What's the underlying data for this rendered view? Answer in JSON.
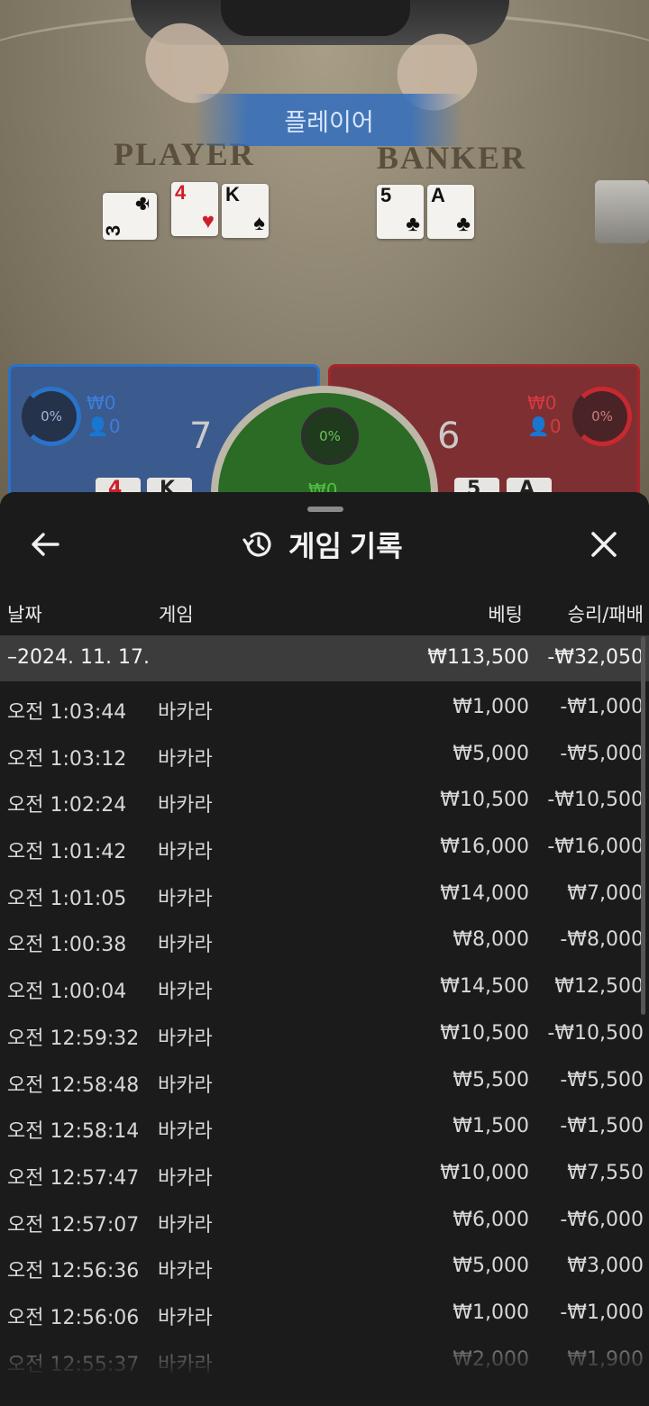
{
  "game": {
    "result_banner": "플레이어",
    "player_label": "PLAYER",
    "banker_label": "BANKER",
    "player_cards": [
      {
        "rank": "3",
        "suit": "♣",
        "color": "black"
      },
      {
        "rank": "4",
        "suit": "♥",
        "color": "red"
      },
      {
        "rank": "K",
        "suit": "♠",
        "color": "black"
      }
    ],
    "banker_cards": [
      {
        "rank": "5",
        "suit": "♣",
        "color": "black"
      },
      {
        "rank": "A",
        "suit": "♣",
        "color": "black"
      }
    ],
    "player_panel": {
      "percent": "0%",
      "amount": "₩0",
      "count": "0",
      "score": "7",
      "color": "#2a73c9"
    },
    "banker_panel": {
      "percent": "0%",
      "amount": "₩0",
      "count": "0",
      "score": "6",
      "color": "#c8282f"
    },
    "tie_panel": {
      "percent": "0%",
      "amount": "₩0",
      "color": "#2b6b25"
    }
  },
  "sheet": {
    "title": "게임 기록",
    "title_icon": "history-icon",
    "back_icon": "arrow-left-icon",
    "close_icon": "close-icon",
    "columns": {
      "date": "날짜",
      "game": "게임",
      "bet": "베팅",
      "result": "승리/패배"
    },
    "summary": {
      "date": "–2024. 11. 17.",
      "bet": "₩113,500",
      "result": "-₩32,050"
    },
    "rows": [
      {
        "time": "오전 1:03:44",
        "game": "바카라",
        "bet": "₩1,000",
        "result": "-₩1,000"
      },
      {
        "time": "오전 1:03:12",
        "game": "바카라",
        "bet": "₩5,000",
        "result": "-₩5,000"
      },
      {
        "time": "오전 1:02:24",
        "game": "바카라",
        "bet": "₩10,500",
        "result": "-₩10,500"
      },
      {
        "time": "오전 1:01:42",
        "game": "바카라",
        "bet": "₩16,000",
        "result": "-₩16,000"
      },
      {
        "time": "오전 1:01:05",
        "game": "바카라",
        "bet": "₩14,000",
        "result": "₩7,000"
      },
      {
        "time": "오전 1:00:38",
        "game": "바카라",
        "bet": "₩8,000",
        "result": "-₩8,000"
      },
      {
        "time": "오전 1:00:04",
        "game": "바카라",
        "bet": "₩14,500",
        "result": "₩12,500"
      },
      {
        "time": "오전 12:59:32",
        "game": "바카라",
        "bet": "₩10,500",
        "result": "-₩10,500"
      },
      {
        "time": "오전 12:58:48",
        "game": "바카라",
        "bet": "₩5,500",
        "result": "-₩5,500"
      },
      {
        "time": "오전 12:58:14",
        "game": "바카라",
        "bet": "₩1,500",
        "result": "-₩1,500"
      },
      {
        "time": "오전 12:57:47",
        "game": "바카라",
        "bet": "₩10,000",
        "result": "₩7,550"
      },
      {
        "time": "오전 12:57:07",
        "game": "바카라",
        "bet": "₩6,000",
        "result": "-₩6,000"
      },
      {
        "time": "오전 12:56:36",
        "game": "바카라",
        "bet": "₩5,000",
        "result": "₩3,000"
      },
      {
        "time": "오전 12:56:06",
        "game": "바카라",
        "bet": "₩1,000",
        "result": "-₩1,000"
      },
      {
        "time": "오전 12:55:37",
        "game": "바카라",
        "bet": "₩2,000",
        "result": "₩1,900"
      }
    ]
  }
}
